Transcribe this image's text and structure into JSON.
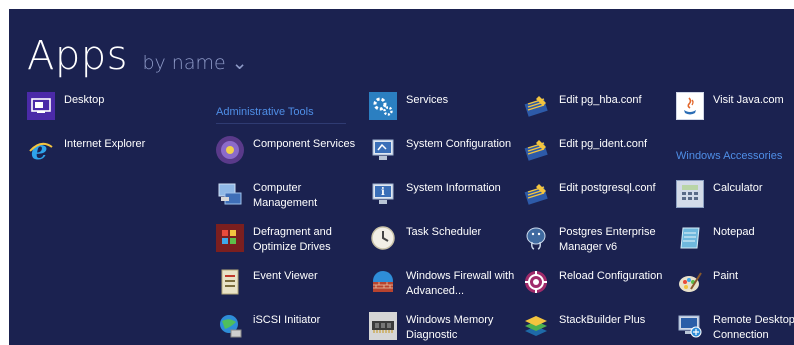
{
  "header": {
    "title": "Apps",
    "sort_label": "by name",
    "sort_chevron": "⌄"
  },
  "colors": {
    "background": "#1b2250",
    "group_header": "#4f8ee6",
    "sort_label": "#8e9ac8"
  },
  "columns": [
    {
      "items": [
        {
          "label": "Desktop",
          "icon": "desktop-icon"
        },
        {
          "label": "Internet Explorer",
          "icon": "internet-explorer-icon"
        }
      ]
    },
    {
      "group": "Administrative Tools",
      "items": [
        {
          "label": "Component Services",
          "icon": "component-services-icon"
        },
        {
          "label": "Computer Management",
          "icon": "computer-management-icon"
        },
        {
          "label": "Defragment and Optimize Drives",
          "icon": "defragment-icon"
        },
        {
          "label": "Event Viewer",
          "icon": "event-viewer-icon"
        },
        {
          "label": "iSCSI Initiator",
          "icon": "iscsi-initiator-icon"
        }
      ]
    },
    {
      "items": [
        {
          "label": "Services",
          "icon": "services-icon"
        },
        {
          "label": "System Configuration",
          "icon": "system-configuration-icon"
        },
        {
          "label": "System Information",
          "icon": "system-information-icon"
        },
        {
          "label": "Task Scheduler",
          "icon": "task-scheduler-icon"
        },
        {
          "label": "Windows Firewall with Advanced...",
          "icon": "windows-firewall-icon"
        },
        {
          "label": "Windows Memory Diagnostic",
          "icon": "memory-diagnostic-icon"
        }
      ]
    },
    {
      "items": [
        {
          "label": "Edit pg_hba.conf",
          "icon": "edit-config-icon"
        },
        {
          "label": "Edit pg_ident.conf",
          "icon": "edit-config-icon"
        },
        {
          "label": "Edit postgresql.conf",
          "icon": "edit-config-icon"
        },
        {
          "label": "Postgres Enterprise Manager v6",
          "icon": "postgres-elephant-icon"
        },
        {
          "label": "Reload Configuration",
          "icon": "reload-configuration-icon"
        },
        {
          "label": "StackBuilder Plus",
          "icon": "stackbuilder-icon"
        }
      ]
    },
    {
      "items": [
        {
          "label": "Visit Java.com",
          "icon": "java-icon"
        }
      ],
      "group2": "Windows Accessories",
      "items2": [
        {
          "label": "Calculator",
          "icon": "calculator-icon"
        },
        {
          "label": "Notepad",
          "icon": "notepad-icon"
        },
        {
          "label": "Paint",
          "icon": "paint-icon"
        },
        {
          "label": "Remote Desktop Connection",
          "icon": "remote-desktop-icon"
        }
      ]
    }
  ]
}
